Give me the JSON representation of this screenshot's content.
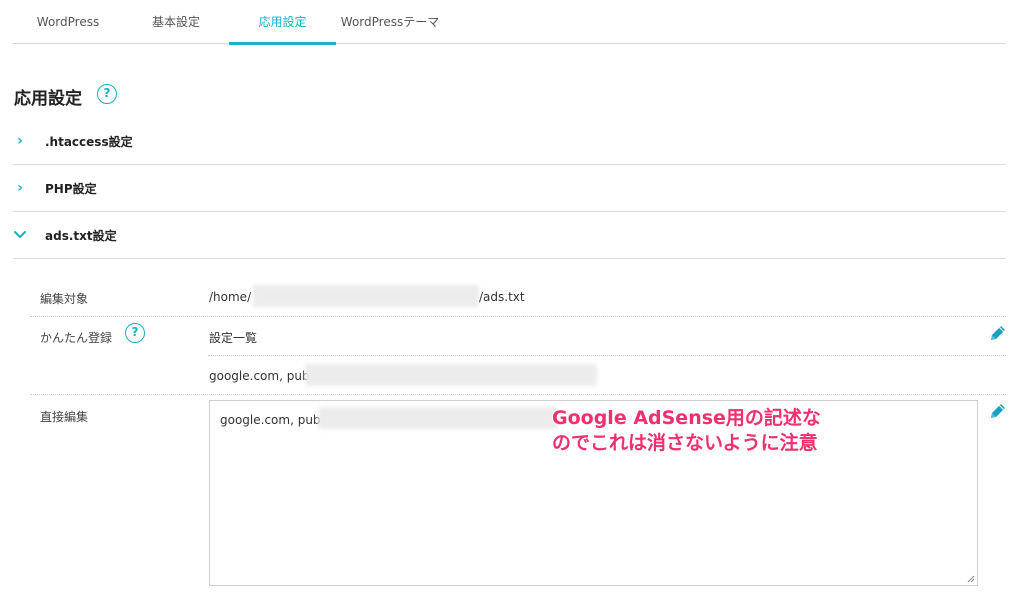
{
  "tabs": [
    {
      "label": "WordPress",
      "active": false
    },
    {
      "label": "基本設定",
      "active": false
    },
    {
      "label": "応用設定",
      "active": true
    },
    {
      "label": "WordPressテーマ",
      "active": false
    }
  ],
  "page": {
    "title": "応用設定",
    "help_icon": "question-circle-icon"
  },
  "sections": [
    {
      "label": ".htaccess設定",
      "expanded": false
    },
    {
      "label": "PHP設定",
      "expanded": false
    },
    {
      "label": "ads.txt設定",
      "expanded": true
    }
  ],
  "ads_txt": {
    "target_label": "編集対象",
    "target_path_prefix": "/home/",
    "target_path_suffix": "/ads.txt",
    "simple_label": "かんたん登録",
    "settings_list_label": "設定一覧",
    "entry_value": "google.com, pub-",
    "direct_label": "直接編集",
    "textarea_value": "google.com, pub-"
  },
  "annotation": {
    "text": "Google AdSense用の記述な\nのでこれは消さないように注意",
    "color": "#f0306e"
  },
  "colors": {
    "accent": "#1ab0c8",
    "edit_icon": "#1aa0c0"
  },
  "icons": {
    "chevron_collapsed": "›",
    "chevron_expanded": "⌄",
    "edit": "pencil-icon"
  }
}
